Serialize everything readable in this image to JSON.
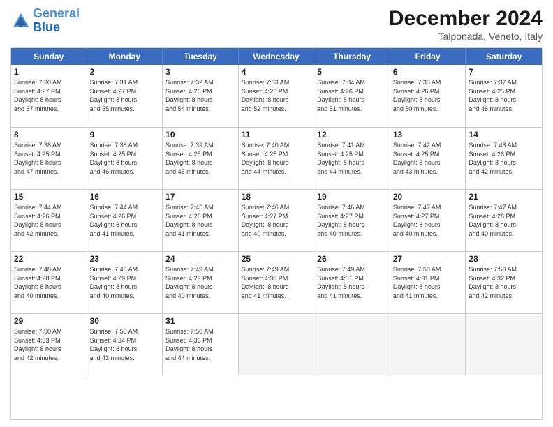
{
  "logo": {
    "line1": "General",
    "line2": "Blue"
  },
  "title": "December 2024",
  "subtitle": "Talponada, Veneto, Italy",
  "header_days": [
    "Sunday",
    "Monday",
    "Tuesday",
    "Wednesday",
    "Thursday",
    "Friday",
    "Saturday"
  ],
  "weeks": [
    [
      {
        "day": "1",
        "lines": [
          "Sunrise: 7:30 AM",
          "Sunset: 4:27 PM",
          "Daylight: 8 hours",
          "and 57 minutes."
        ]
      },
      {
        "day": "2",
        "lines": [
          "Sunrise: 7:31 AM",
          "Sunset: 4:27 PM",
          "Daylight: 8 hours",
          "and 55 minutes."
        ]
      },
      {
        "day": "3",
        "lines": [
          "Sunrise: 7:32 AM",
          "Sunset: 4:26 PM",
          "Daylight: 8 hours",
          "and 54 minutes."
        ]
      },
      {
        "day": "4",
        "lines": [
          "Sunrise: 7:33 AM",
          "Sunset: 4:26 PM",
          "Daylight: 8 hours",
          "and 52 minutes."
        ]
      },
      {
        "day": "5",
        "lines": [
          "Sunrise: 7:34 AM",
          "Sunset: 4:26 PM",
          "Daylight: 8 hours",
          "and 51 minutes."
        ]
      },
      {
        "day": "6",
        "lines": [
          "Sunrise: 7:35 AM",
          "Sunset: 4:26 PM",
          "Daylight: 8 hours",
          "and 50 minutes."
        ]
      },
      {
        "day": "7",
        "lines": [
          "Sunrise: 7:37 AM",
          "Sunset: 4:25 PM",
          "Daylight: 8 hours",
          "and 48 minutes."
        ]
      }
    ],
    [
      {
        "day": "8",
        "lines": [
          "Sunrise: 7:38 AM",
          "Sunset: 4:25 PM",
          "Daylight: 8 hours",
          "and 47 minutes."
        ]
      },
      {
        "day": "9",
        "lines": [
          "Sunrise: 7:38 AM",
          "Sunset: 4:25 PM",
          "Daylight: 8 hours",
          "and 46 minutes."
        ]
      },
      {
        "day": "10",
        "lines": [
          "Sunrise: 7:39 AM",
          "Sunset: 4:25 PM",
          "Daylight: 8 hours",
          "and 45 minutes."
        ]
      },
      {
        "day": "11",
        "lines": [
          "Sunrise: 7:40 AM",
          "Sunset: 4:25 PM",
          "Daylight: 8 hours",
          "and 44 minutes."
        ]
      },
      {
        "day": "12",
        "lines": [
          "Sunrise: 7:41 AM",
          "Sunset: 4:25 PM",
          "Daylight: 8 hours",
          "and 44 minutes."
        ]
      },
      {
        "day": "13",
        "lines": [
          "Sunrise: 7:42 AM",
          "Sunset: 4:25 PM",
          "Daylight: 8 hours",
          "and 43 minutes."
        ]
      },
      {
        "day": "14",
        "lines": [
          "Sunrise: 7:43 AM",
          "Sunset: 4:26 PM",
          "Daylight: 8 hours",
          "and 42 minutes."
        ]
      }
    ],
    [
      {
        "day": "15",
        "lines": [
          "Sunrise: 7:44 AM",
          "Sunset: 4:26 PM",
          "Daylight: 8 hours",
          "and 42 minutes."
        ]
      },
      {
        "day": "16",
        "lines": [
          "Sunrise: 7:44 AM",
          "Sunset: 4:26 PM",
          "Daylight: 8 hours",
          "and 41 minutes."
        ]
      },
      {
        "day": "17",
        "lines": [
          "Sunrise: 7:45 AM",
          "Sunset: 4:26 PM",
          "Daylight: 8 hours",
          "and 41 minutes."
        ]
      },
      {
        "day": "18",
        "lines": [
          "Sunrise: 7:46 AM",
          "Sunset: 4:27 PM",
          "Daylight: 8 hours",
          "and 40 minutes."
        ]
      },
      {
        "day": "19",
        "lines": [
          "Sunrise: 7:46 AM",
          "Sunset: 4:27 PM",
          "Daylight: 8 hours",
          "and 40 minutes."
        ]
      },
      {
        "day": "20",
        "lines": [
          "Sunrise: 7:47 AM",
          "Sunset: 4:27 PM",
          "Daylight: 8 hours",
          "and 40 minutes."
        ]
      },
      {
        "day": "21",
        "lines": [
          "Sunrise: 7:47 AM",
          "Sunset: 4:28 PM",
          "Daylight: 8 hours",
          "and 40 minutes."
        ]
      }
    ],
    [
      {
        "day": "22",
        "lines": [
          "Sunrise: 7:48 AM",
          "Sunset: 4:28 PM",
          "Daylight: 8 hours",
          "and 40 minutes."
        ]
      },
      {
        "day": "23",
        "lines": [
          "Sunrise: 7:48 AM",
          "Sunset: 4:29 PM",
          "Daylight: 8 hours",
          "and 40 minutes."
        ]
      },
      {
        "day": "24",
        "lines": [
          "Sunrise: 7:49 AM",
          "Sunset: 4:29 PM",
          "Daylight: 8 hours",
          "and 40 minutes."
        ]
      },
      {
        "day": "25",
        "lines": [
          "Sunrise: 7:49 AM",
          "Sunset: 4:30 PM",
          "Daylight: 8 hours",
          "and 41 minutes."
        ]
      },
      {
        "day": "26",
        "lines": [
          "Sunrise: 7:49 AM",
          "Sunset: 4:31 PM",
          "Daylight: 8 hours",
          "and 41 minutes."
        ]
      },
      {
        "day": "27",
        "lines": [
          "Sunrise: 7:50 AM",
          "Sunset: 4:31 PM",
          "Daylight: 8 hours",
          "and 41 minutes."
        ]
      },
      {
        "day": "28",
        "lines": [
          "Sunrise: 7:50 AM",
          "Sunset: 4:32 PM",
          "Daylight: 8 hours",
          "and 42 minutes."
        ]
      }
    ],
    [
      {
        "day": "29",
        "lines": [
          "Sunrise: 7:50 AM",
          "Sunset: 4:33 PM",
          "Daylight: 8 hours",
          "and 42 minutes."
        ]
      },
      {
        "day": "30",
        "lines": [
          "Sunrise: 7:50 AM",
          "Sunset: 4:34 PM",
          "Daylight: 8 hours",
          "and 43 minutes."
        ]
      },
      {
        "day": "31",
        "lines": [
          "Sunrise: 7:50 AM",
          "Sunset: 4:35 PM",
          "Daylight: 8 hours",
          "and 44 minutes."
        ]
      },
      {
        "day": "",
        "lines": []
      },
      {
        "day": "",
        "lines": []
      },
      {
        "day": "",
        "lines": []
      },
      {
        "day": "",
        "lines": []
      }
    ]
  ]
}
